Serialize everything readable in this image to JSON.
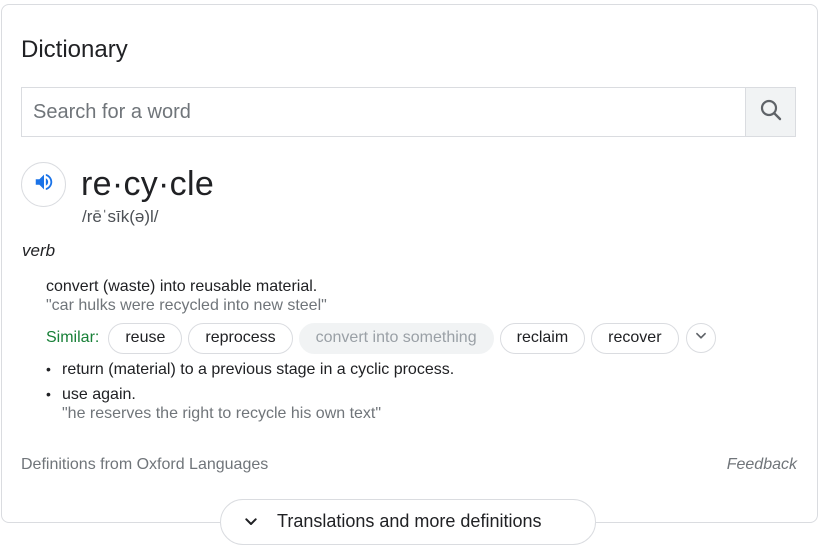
{
  "title": "Dictionary",
  "search": {
    "placeholder": "Search for a word"
  },
  "entry": {
    "headword": "re·cy·cle",
    "phonetic": "/rēˈsīk(ə)l/",
    "part_of_speech": "verb",
    "senses": [
      {
        "definition": "convert (waste) into reusable material.",
        "example": "\"car hulks were recycled into new steel\""
      },
      {
        "definition": "return (material) to a previous stage in a cyclic process.",
        "example": ""
      },
      {
        "definition": "use again.",
        "example": "\"he reserves the right to recycle his own text\""
      }
    ],
    "similar_label": "Similar:",
    "similar": [
      "reuse",
      "reprocess",
      "convert into something",
      "reclaim",
      "recover"
    ]
  },
  "footer": {
    "source": "Definitions from Oxford Languages",
    "feedback": "Feedback"
  },
  "more_button": {
    "label": "Translations and more definitions"
  },
  "colors": {
    "accent_blue": "#1a73e8",
    "similar_green": "#188038",
    "border": "#dadce0"
  }
}
